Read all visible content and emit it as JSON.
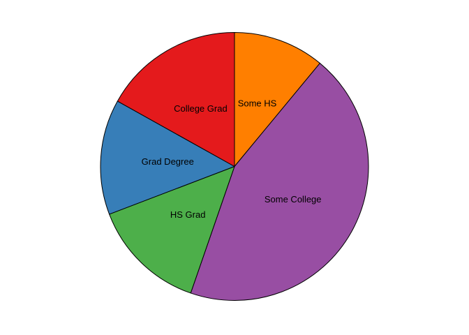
{
  "chart_data": {
    "type": "pie",
    "title": "",
    "start": "12 o'clock",
    "direction": "clockwise",
    "legend": "none",
    "slices": [
      {
        "label": "Some HS",
        "value": 11.0,
        "color": "#FF7F00"
      },
      {
        "label": "Some College",
        "value": 44.3,
        "color": "#984EA3"
      },
      {
        "label": "HS Grad",
        "value": 13.9,
        "color": "#4DAF4A"
      },
      {
        "label": "Grad Degree",
        "value": 13.9,
        "color": "#377EB8"
      },
      {
        "label": "College Grad",
        "value": 16.9,
        "color": "#E41A1C"
      }
    ]
  }
}
